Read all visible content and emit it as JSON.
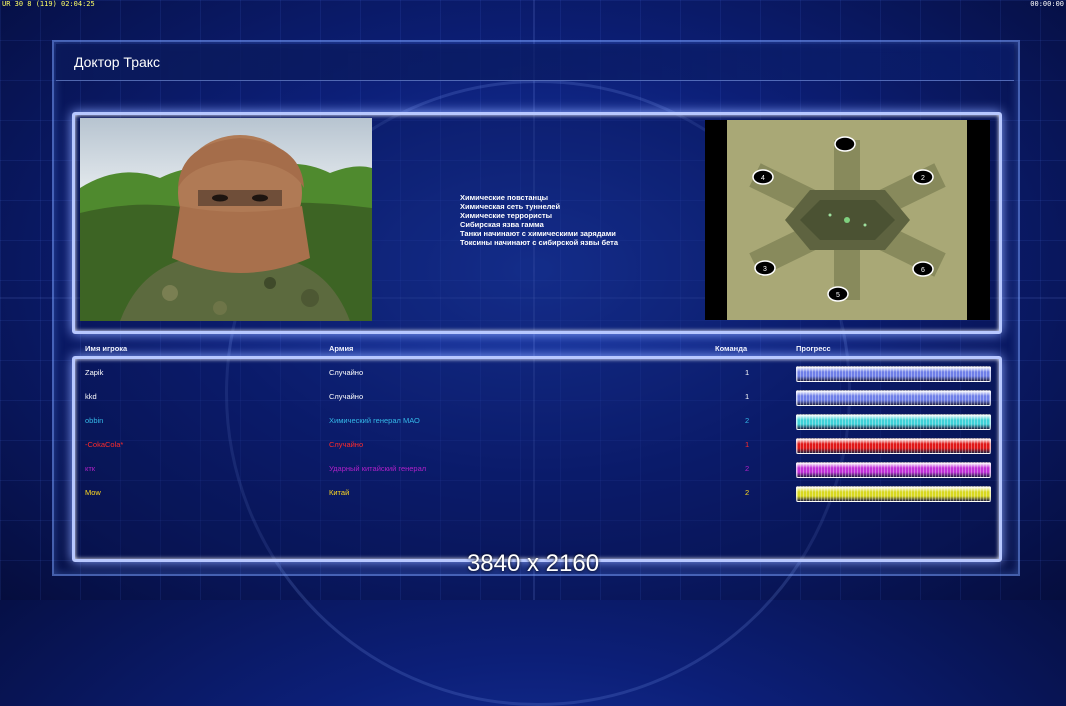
{
  "hud": {
    "top_left": "UR 30 8 (119) 02:04:25",
    "top_right": "00:00:00"
  },
  "title": "Доктор Тракс",
  "objectives": [
    "Химические повстанцы",
    "Химическая сеть туннелей",
    "Химические террористы",
    "Сибирская язва гамма",
    "Танки начинают с химическими зарядами",
    "Токсины начинают с сибирской язвы бета"
  ],
  "map": {
    "start_positions": [
      "4",
      "2",
      "3",
      "6",
      "5"
    ]
  },
  "table": {
    "headers": {
      "name": "Имя игрока",
      "army": "Армия",
      "team": "Команда",
      "progress": "Прогресс"
    },
    "rows": [
      {
        "name": "Zapik",
        "army": "Случайно",
        "team": "1",
        "color": "#ffffff",
        "bar_color": "#6f7fe8"
      },
      {
        "name": "kkd",
        "army": "Случайно",
        "team": "1",
        "color": "#ffffff",
        "bar_color": "#6f7fe8"
      },
      {
        "name": "obbin",
        "army": "Химический генерал МАО",
        "team": "2",
        "color": "#35b8e8",
        "bar_color": "#3fd2d8"
      },
      {
        "name": "-CokaCola*",
        "army": "Случайно",
        "team": "1",
        "color": "#ff2a2a",
        "bar_color": "#e01818"
      },
      {
        "name": "ктк",
        "army": "Ударный китайский генерал",
        "team": "2",
        "color": "#b020c8",
        "bar_color": "#c030d8"
      },
      {
        "name": "Mow",
        "army": "Китай",
        "team": "2",
        "color": "#ffd820",
        "bar_color": "#d8d820"
      }
    ]
  },
  "watermark": "3840 x 2160"
}
